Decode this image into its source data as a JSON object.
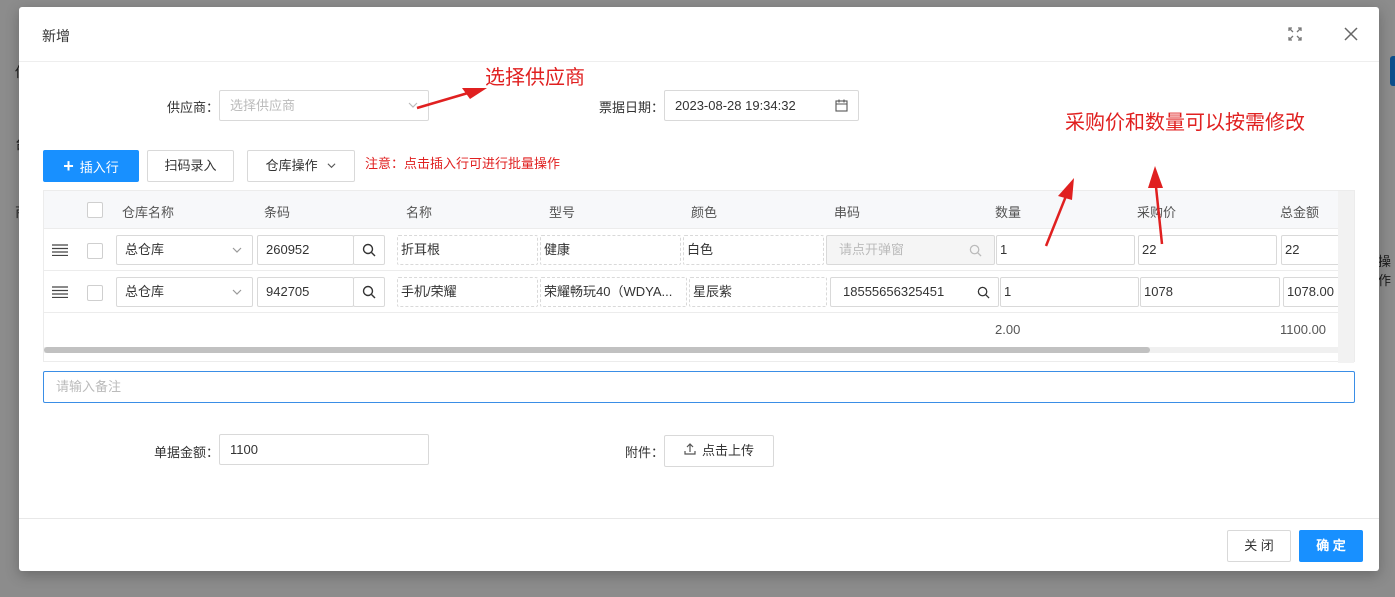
{
  "background": {
    "fragments": [
      "供",
      "台",
      "商",
      "操作"
    ]
  },
  "modal": {
    "title": "新增",
    "supplier": {
      "label": "供应商：",
      "placeholder": "选择供应商"
    },
    "bill_date": {
      "label": "票据日期：",
      "value": "2023-08-28 19:34:32"
    },
    "toolbar": {
      "insert_row": "插入行",
      "scan_input": "扫码录入",
      "warehouse_ops": "仓库操作",
      "note": "注意：点击插入行可进行批量操作"
    },
    "table": {
      "columns": [
        "仓库名称",
        "条码",
        "名称",
        "型号",
        "颜色",
        "串码",
        "数量",
        "采购价",
        "总金额"
      ],
      "rows": [
        {
          "warehouse": "总仓库",
          "barcode": "260952",
          "name": "折耳根",
          "model": "健康",
          "color": "白色",
          "serial": "请点开弹窗",
          "qty": "1",
          "price": "22",
          "total": "22"
        },
        {
          "warehouse": "总仓库",
          "barcode": "942705",
          "name": "手机/荣耀",
          "model": "荣耀畅玩40（WDYA...",
          "color": "星辰紫",
          "serial": "18555656325451",
          "qty": "1",
          "price": "1078",
          "total": "1078.00"
        }
      ],
      "summary": {
        "qty": "2.00",
        "total": "1100.00"
      }
    },
    "remark_placeholder": "请输入备注",
    "bill_amount": {
      "label": "单据金额：",
      "value": "1100"
    },
    "attachment": {
      "label": "附件：",
      "button": "点击上传"
    },
    "footer": {
      "close": "关 闭",
      "confirm": "确 定"
    }
  },
  "annotations": {
    "supplier_hint": "选择供应商",
    "edit_hint": "采购价和数量可以按需修改"
  },
  "colors": {
    "primary": "#1890ff",
    "annotation": "#e02020"
  }
}
